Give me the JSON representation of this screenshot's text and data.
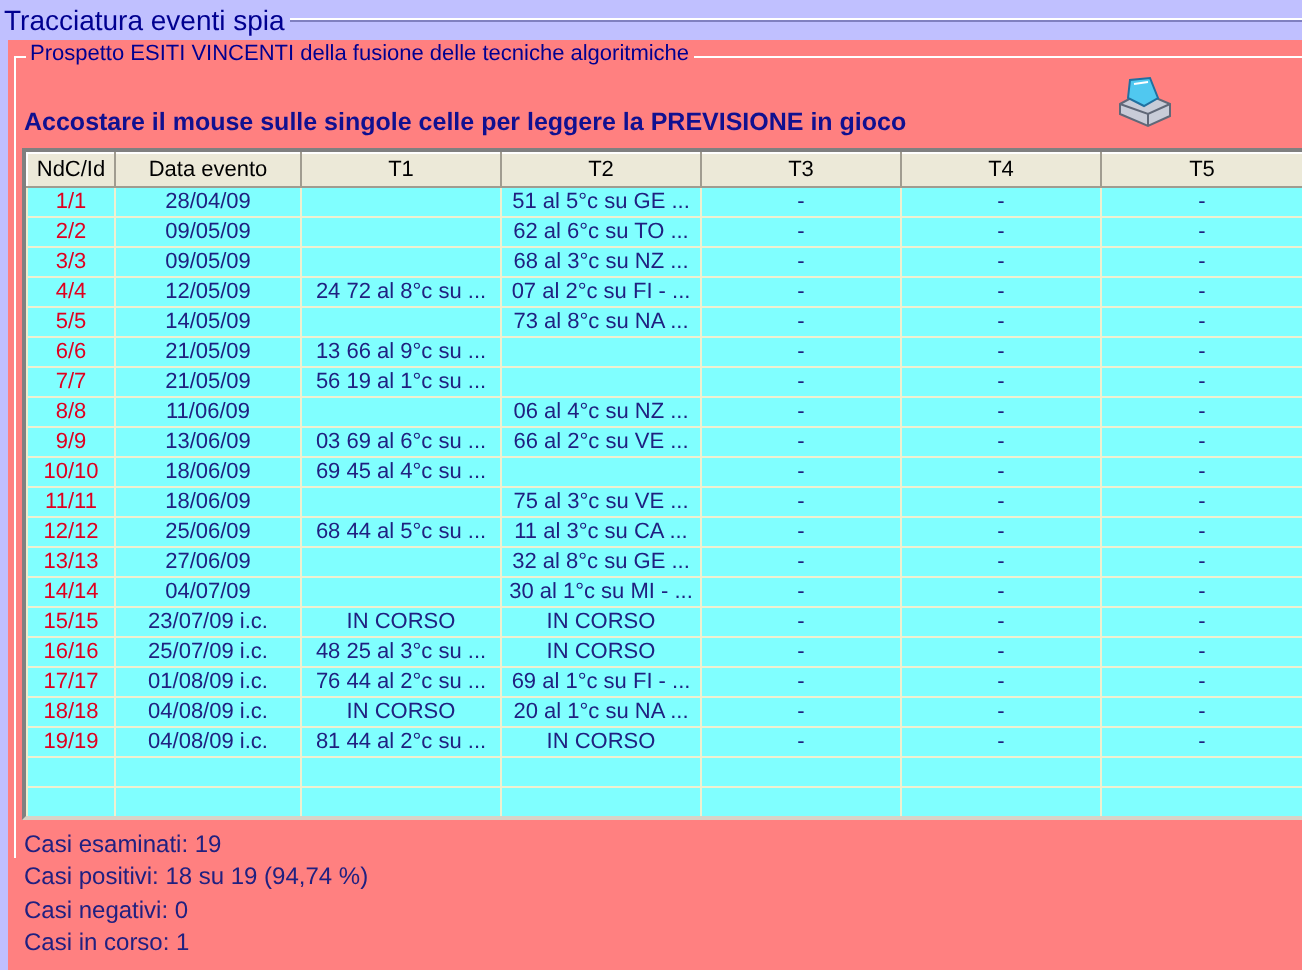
{
  "window": {
    "title": "Tracciatura eventi spia"
  },
  "panel": {
    "legend": "Prospetto ESITI VINCENTI della fusione delle tecniche algoritmiche",
    "instruction": "Accostare il mouse sulle singole celle per leggere la PREVISIONE in gioco"
  },
  "table": {
    "columns": [
      "NdC/Id",
      "Data evento",
      "T1",
      "T2",
      "T3",
      "T4",
      "T5"
    ],
    "rows": [
      {
        "id": "1/1",
        "date": "28/04/09",
        "t2": "51 al 5°c su GE ...",
        "t3": "-",
        "t4": "-",
        "t5": "-"
      },
      {
        "id": "2/2",
        "date": "09/05/09",
        "t2": "62 al 6°c su TO ...",
        "t3": "-",
        "t4": "-",
        "t5": "-"
      },
      {
        "id": "3/3",
        "date": "09/05/09",
        "t2": "68 al 3°c su NZ ...",
        "t3": "-",
        "t4": "-",
        "t5": "-"
      },
      {
        "id": "4/4",
        "date": "12/05/09",
        "t1": "24 72 al 8°c su ...",
        "t2": "07 al 2°c su FI - ...",
        "t3": "-",
        "t4": "-",
        "t5": "-"
      },
      {
        "id": "5/5",
        "date": "14/05/09",
        "t2": "73 al 8°c su NA ...",
        "t3": "-",
        "t4": "-",
        "t5": "-"
      },
      {
        "id": "6/6",
        "date": "21/05/09",
        "t1": "13 66 al 9°c su ...",
        "t3": "-",
        "t4": "-",
        "t5": "-"
      },
      {
        "id": "7/7",
        "date": "21/05/09",
        "t1": "56 19 al 1°c su ...",
        "t3": "-",
        "t4": "-",
        "t5": "-"
      },
      {
        "id": "8/8",
        "date": "11/06/09",
        "t2": "06 al 4°c su NZ ...",
        "t3": "-",
        "t4": "-",
        "t5": "-"
      },
      {
        "id": "9/9",
        "date": "13/06/09",
        "t1": "03 69 al 6°c su ...",
        "t2": "66 al 2°c su VE ...",
        "t3": "-",
        "t4": "-",
        "t5": "-"
      },
      {
        "id": "10/10",
        "date": "18/06/09",
        "t1": "69 45 al 4°c su ...",
        "t3": "-",
        "t4": "-",
        "t5": "-"
      },
      {
        "id": "11/11",
        "date": "18/06/09",
        "t2": "75 al 3°c su VE ...",
        "t3": "-",
        "t4": "-",
        "t5": "-"
      },
      {
        "id": "12/12",
        "date": "25/06/09",
        "t1": "68 44 al 5°c su ...",
        "t2": "11 al 3°c su CA ...",
        "t3": "-",
        "t4": "-",
        "t5": "-"
      },
      {
        "id": "13/13",
        "date": "27/06/09",
        "t2": "32 al 8°c su GE ...",
        "t3": "-",
        "t4": "-",
        "t5": "-"
      },
      {
        "id": "14/14",
        "date": "04/07/09",
        "t2": "30 al 1°c su MI - ...",
        "t3": "-",
        "t4": "-",
        "t5": "-"
      },
      {
        "id": "15/15",
        "date": "23/07/09 i.c.",
        "t1": "IN CORSO",
        "t2": "IN CORSO",
        "t3": "-",
        "t4": "-",
        "t5": "-"
      },
      {
        "id": "16/16",
        "date": "25/07/09 i.c.",
        "t1": "48 25 al 3°c su ...",
        "t2": "IN CORSO",
        "t3": "-",
        "t4": "-",
        "t5": "-"
      },
      {
        "id": "17/17",
        "date": "01/08/09 i.c.",
        "t1": "76 44 al 2°c su ...",
        "t2": "69 al 1°c su FI - ...",
        "t3": "-",
        "t4": "-",
        "t5": "-"
      },
      {
        "id": "18/18",
        "date": "04/08/09 i.c.",
        "t1": "IN CORSO",
        "t2": "20 al 1°c su NA ...",
        "t3": "-",
        "t4": "-",
        "t5": "-"
      },
      {
        "id": "19/19",
        "date": "04/08/09 i.c.",
        "t1": "81 44 al 2°c su ...",
        "t2": "IN CORSO",
        "t3": "-",
        "t4": "-",
        "t5": "-"
      }
    ]
  },
  "summary": [
    "Casi esaminati: 19",
    "Casi positivi: 18 su 19 (94,74 %)",
    "Casi negativi: 0",
    "Casi in corso: 1"
  ]
}
